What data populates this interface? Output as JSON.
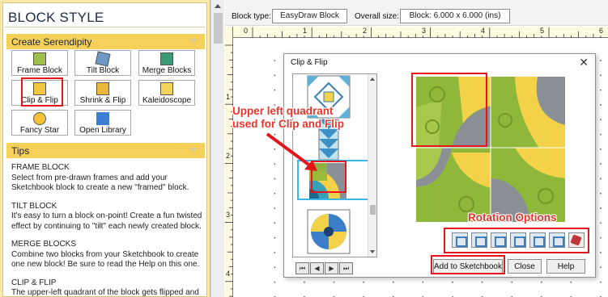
{
  "left_panel": {
    "title": "BLOCK STYLE",
    "serendipity_header": "Create Serendipity",
    "tools": [
      {
        "label": "Frame Block",
        "icon": "frame-block-icon"
      },
      {
        "label": "Tilt Block",
        "icon": "tilt-block-icon"
      },
      {
        "label": "Merge Blocks",
        "icon": "merge-blocks-icon"
      },
      {
        "label": "Clip & Flip",
        "icon": "clip-flip-icon"
      },
      {
        "label": "Shrink & Flip",
        "icon": "shrink-flip-icon"
      },
      {
        "label": "Kaleidoscope",
        "icon": "kaleidoscope-icon"
      },
      {
        "label": "Fancy Star",
        "icon": "fancy-star-icon"
      },
      {
        "label": "Open Library",
        "icon": "open-library-icon"
      }
    ],
    "tips_header": "Tips",
    "tips": [
      {
        "heading": "FRAME BLOCK",
        "text": "Select from pre-drawn frames and add your Sketchbook block to create a new \"framed\" block."
      },
      {
        "heading": "TILT BLOCK",
        "text": "It's easy to turn a block on-point! Create a fun twisted effect by continuing to \"tilt\" each newly created block."
      },
      {
        "heading": "MERGE BLOCKS",
        "text": "Combine two blocks from your Sketchbook to create one new block! Be sure to read the Help on this one."
      },
      {
        "heading": "CLIP & FLIP",
        "text": "The upper-left quadrant of the block gets flipped and"
      }
    ]
  },
  "topbar": {
    "block_type_label": "Block type:",
    "block_type_value": "EasyDraw Block",
    "overall_size_label": "Overall size:",
    "overall_size_value": "Block: 6.000 x 6.000 (ins)"
  },
  "ruler": {
    "h_labels": [
      "0",
      "1",
      "2",
      "3",
      "4",
      "5",
      "6"
    ],
    "v_labels": [
      "1",
      "2",
      "3",
      "4"
    ]
  },
  "dialog": {
    "title": "Clip & Flip",
    "close_glyph": "✕",
    "nav_buttons": [
      "⏮",
      "◀",
      "▶",
      "⏭"
    ],
    "add_button": "Add to Sketchbook",
    "close_button": "Close",
    "help_button": "Help",
    "rotation_icons": [
      "rotate-option-1-icon",
      "rotate-option-2-icon",
      "rotate-option-3-icon",
      "rotate-option-4-icon",
      "rotate-option-5-icon",
      "rotate-option-6-icon",
      "random-dice-icon"
    ]
  },
  "annotations": {
    "quadrant_note_line1": "Upper left quadrant",
    "quadrant_note_line2": "used for Clip and Flip",
    "rotation_note": "Rotation Options"
  },
  "colors": {
    "annotation_red": "#e3171b",
    "panel_yellow": "#f6d15a",
    "quilt_green": "#8fb73a",
    "quilt_yellow": "#f3d24a",
    "quilt_gray": "#8b8f96"
  }
}
